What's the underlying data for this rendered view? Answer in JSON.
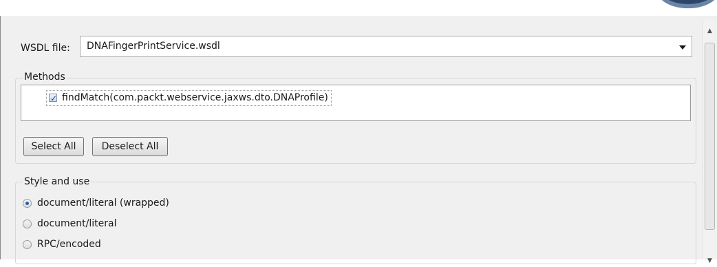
{
  "wsdl": {
    "label": "WSDL file:",
    "selected": "DNAFingerPrintService.wsdl"
  },
  "methods": {
    "title": "Methods",
    "items": [
      {
        "label": "findMatch(com.packt.webservice.jaxws.dto.DNAProfile)",
        "checked": true
      }
    ],
    "select_all_label": "Select All",
    "deselect_all_label": "Deselect All"
  },
  "style_and_use": {
    "title": "Style and use",
    "options": [
      {
        "label": "document/literal (wrapped)",
        "selected": true
      },
      {
        "label": "document/literal",
        "selected": false
      },
      {
        "label": "RPC/encoded",
        "selected": false
      }
    ]
  }
}
